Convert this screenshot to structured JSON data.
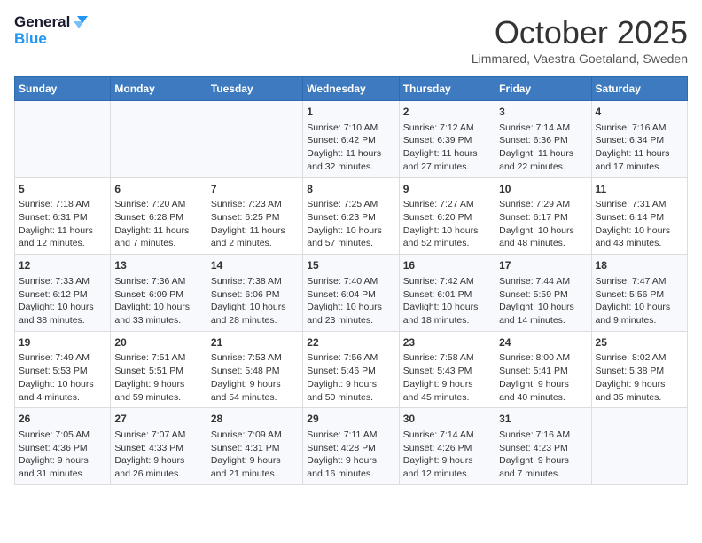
{
  "header": {
    "logo_line1": "General",
    "logo_line2": "Blue",
    "month": "October 2025",
    "location": "Limmared, Vaestra Goetaland, Sweden"
  },
  "days_of_week": [
    "Sunday",
    "Monday",
    "Tuesday",
    "Wednesday",
    "Thursday",
    "Friday",
    "Saturday"
  ],
  "weeks": [
    [
      {
        "day": "",
        "info": ""
      },
      {
        "day": "",
        "info": ""
      },
      {
        "day": "",
        "info": ""
      },
      {
        "day": "1",
        "info": "Sunrise: 7:10 AM\nSunset: 6:42 PM\nDaylight: 11 hours\nand 32 minutes."
      },
      {
        "day": "2",
        "info": "Sunrise: 7:12 AM\nSunset: 6:39 PM\nDaylight: 11 hours\nand 27 minutes."
      },
      {
        "day": "3",
        "info": "Sunrise: 7:14 AM\nSunset: 6:36 PM\nDaylight: 11 hours\nand 22 minutes."
      },
      {
        "day": "4",
        "info": "Sunrise: 7:16 AM\nSunset: 6:34 PM\nDaylight: 11 hours\nand 17 minutes."
      }
    ],
    [
      {
        "day": "5",
        "info": "Sunrise: 7:18 AM\nSunset: 6:31 PM\nDaylight: 11 hours\nand 12 minutes."
      },
      {
        "day": "6",
        "info": "Sunrise: 7:20 AM\nSunset: 6:28 PM\nDaylight: 11 hours\nand 7 minutes."
      },
      {
        "day": "7",
        "info": "Sunrise: 7:23 AM\nSunset: 6:25 PM\nDaylight: 11 hours\nand 2 minutes."
      },
      {
        "day": "8",
        "info": "Sunrise: 7:25 AM\nSunset: 6:23 PM\nDaylight: 10 hours\nand 57 minutes."
      },
      {
        "day": "9",
        "info": "Sunrise: 7:27 AM\nSunset: 6:20 PM\nDaylight: 10 hours\nand 52 minutes."
      },
      {
        "day": "10",
        "info": "Sunrise: 7:29 AM\nSunset: 6:17 PM\nDaylight: 10 hours\nand 48 minutes."
      },
      {
        "day": "11",
        "info": "Sunrise: 7:31 AM\nSunset: 6:14 PM\nDaylight: 10 hours\nand 43 minutes."
      }
    ],
    [
      {
        "day": "12",
        "info": "Sunrise: 7:33 AM\nSunset: 6:12 PM\nDaylight: 10 hours\nand 38 minutes."
      },
      {
        "day": "13",
        "info": "Sunrise: 7:36 AM\nSunset: 6:09 PM\nDaylight: 10 hours\nand 33 minutes."
      },
      {
        "day": "14",
        "info": "Sunrise: 7:38 AM\nSunset: 6:06 PM\nDaylight: 10 hours\nand 28 minutes."
      },
      {
        "day": "15",
        "info": "Sunrise: 7:40 AM\nSunset: 6:04 PM\nDaylight: 10 hours\nand 23 minutes."
      },
      {
        "day": "16",
        "info": "Sunrise: 7:42 AM\nSunset: 6:01 PM\nDaylight: 10 hours\nand 18 minutes."
      },
      {
        "day": "17",
        "info": "Sunrise: 7:44 AM\nSunset: 5:59 PM\nDaylight: 10 hours\nand 14 minutes."
      },
      {
        "day": "18",
        "info": "Sunrise: 7:47 AM\nSunset: 5:56 PM\nDaylight: 10 hours\nand 9 minutes."
      }
    ],
    [
      {
        "day": "19",
        "info": "Sunrise: 7:49 AM\nSunset: 5:53 PM\nDaylight: 10 hours\nand 4 minutes."
      },
      {
        "day": "20",
        "info": "Sunrise: 7:51 AM\nSunset: 5:51 PM\nDaylight: 9 hours\nand 59 minutes."
      },
      {
        "day": "21",
        "info": "Sunrise: 7:53 AM\nSunset: 5:48 PM\nDaylight: 9 hours\nand 54 minutes."
      },
      {
        "day": "22",
        "info": "Sunrise: 7:56 AM\nSunset: 5:46 PM\nDaylight: 9 hours\nand 50 minutes."
      },
      {
        "day": "23",
        "info": "Sunrise: 7:58 AM\nSunset: 5:43 PM\nDaylight: 9 hours\nand 45 minutes."
      },
      {
        "day": "24",
        "info": "Sunrise: 8:00 AM\nSunset: 5:41 PM\nDaylight: 9 hours\nand 40 minutes."
      },
      {
        "day": "25",
        "info": "Sunrise: 8:02 AM\nSunset: 5:38 PM\nDaylight: 9 hours\nand 35 minutes."
      }
    ],
    [
      {
        "day": "26",
        "info": "Sunrise: 7:05 AM\nSunset: 4:36 PM\nDaylight: 9 hours\nand 31 minutes."
      },
      {
        "day": "27",
        "info": "Sunrise: 7:07 AM\nSunset: 4:33 PM\nDaylight: 9 hours\nand 26 minutes."
      },
      {
        "day": "28",
        "info": "Sunrise: 7:09 AM\nSunset: 4:31 PM\nDaylight: 9 hours\nand 21 minutes."
      },
      {
        "day": "29",
        "info": "Sunrise: 7:11 AM\nSunset: 4:28 PM\nDaylight: 9 hours\nand 16 minutes."
      },
      {
        "day": "30",
        "info": "Sunrise: 7:14 AM\nSunset: 4:26 PM\nDaylight: 9 hours\nand 12 minutes."
      },
      {
        "day": "31",
        "info": "Sunrise: 7:16 AM\nSunset: 4:23 PM\nDaylight: 9 hours\nand 7 minutes."
      },
      {
        "day": "",
        "info": ""
      }
    ]
  ]
}
